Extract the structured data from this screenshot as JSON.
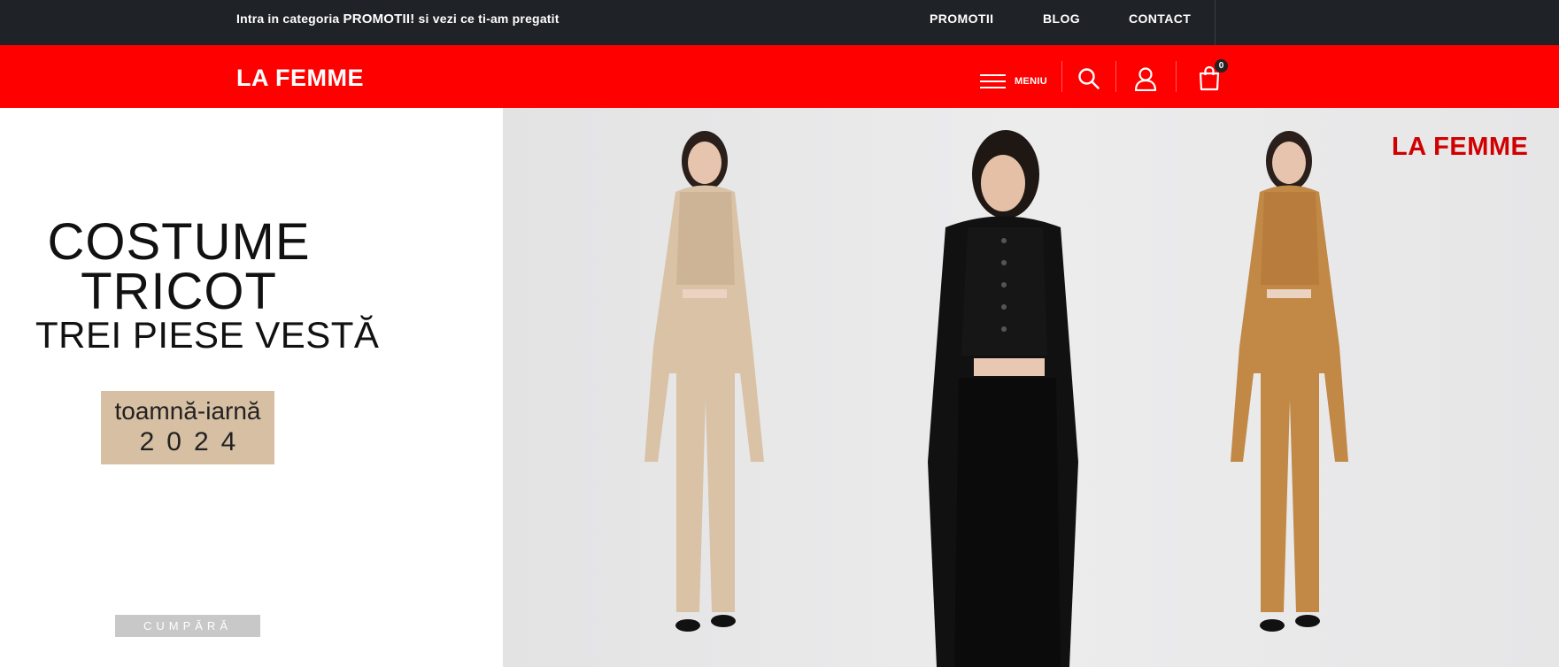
{
  "topbar": {
    "message_prefix": "Intra in categoria ",
    "message_highlight": "PROMOTII!",
    "message_suffix": " si vezi ce ti-am pregatit",
    "nav": [
      "PROMOTII",
      "BLOG",
      "CONTACT"
    ]
  },
  "header": {
    "logo": "LA FEMME",
    "menu_label": "MENIU",
    "cart_count": "0",
    "icons": [
      "hamburger-icon",
      "search-icon",
      "user-icon",
      "shopping-bag-icon"
    ]
  },
  "hero": {
    "title_line1": "COSTUME",
    "title_line2": "TRICOT",
    "title_line3": "TREI PIESE VESTĂ",
    "season_line1": "toamnă-iarnă",
    "season_line2": "2024",
    "cta_label": "CUMPĂRĂ",
    "image_brand": "LA FEMME"
  },
  "colors": {
    "topbar_bg": "#1f2226",
    "brand_red": "#ff0000",
    "season_badge": "#d6bfa3",
    "cta_bg": "#c8c8c8",
    "outfits": [
      "#d9c2a6",
      "#111111",
      "#c28845"
    ]
  }
}
